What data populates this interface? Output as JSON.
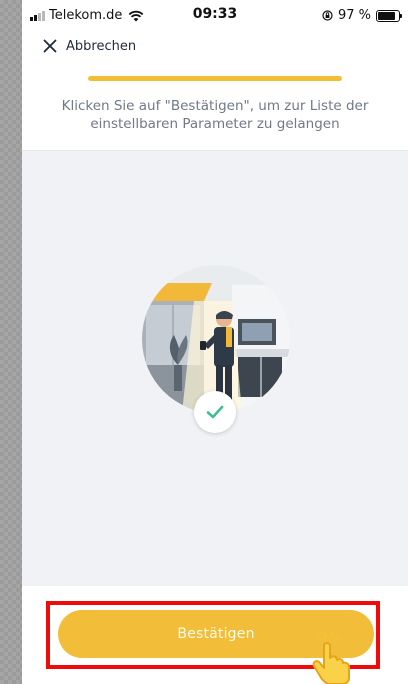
{
  "status_bar": {
    "carrier": "Telekom.de",
    "time": "09:33",
    "battery": "97 %",
    "battery_level": 0.97,
    "icons": [
      "signal-icon",
      "wifi-icon",
      "orientation-lock-icon",
      "battery-icon"
    ]
  },
  "header": {
    "cancel_label": "Abbrechen",
    "cancel_icon": "close-icon",
    "progress": 1.0,
    "instruction": "Klicken Sie auf \"Bestätigen\", um zur Liste der einstellbaren Parameter zu gelangen"
  },
  "illustration": {
    "image": "person-with-smart-home-device",
    "status_icon": "checkmark-icon"
  },
  "footer": {
    "confirm_label": "Bestätigen",
    "tap_hint_icon": "tap-hand-icon"
  },
  "colors": {
    "accent": "#f2be34",
    "highlight": "#ef0b0b",
    "check": "#3ec08c",
    "text_primary": "#1d2a3b",
    "text_secondary": "#6f7a86",
    "background": "#f1f2f5"
  }
}
